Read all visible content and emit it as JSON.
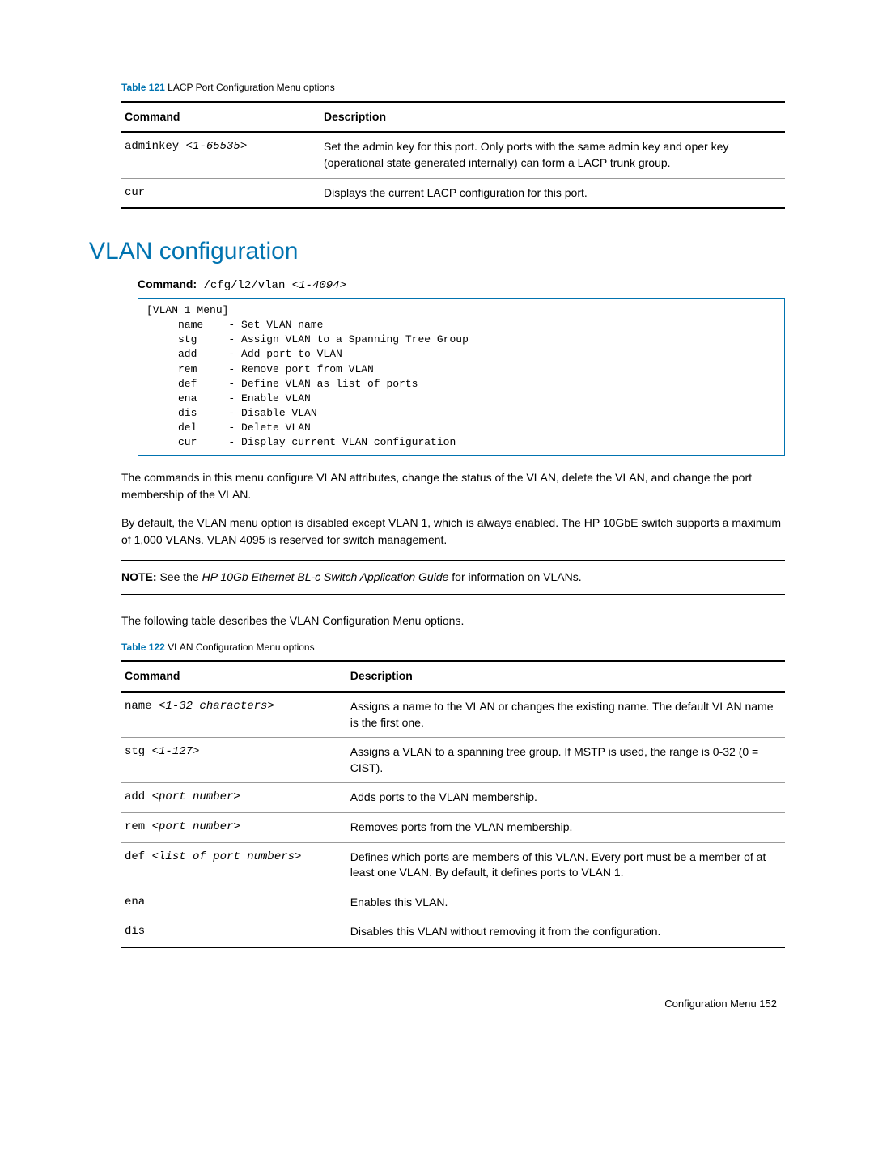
{
  "table121": {
    "caption_num": "Table 121",
    "caption_title": "  LACP Port Configuration Menu options",
    "header_cmd": "Command",
    "header_desc": "Description",
    "rows": [
      {
        "cmd_pre": "adminkey <",
        "cmd_arg": "1-65535",
        "cmd_post": ">",
        "desc": "Set the admin key for this port. Only ports with the same admin key and oper key (operational state generated internally) can form a LACP trunk group."
      },
      {
        "cmd_pre": "cur",
        "cmd_arg": "",
        "cmd_post": "",
        "desc": "Displays the current LACP configuration for this port."
      }
    ]
  },
  "section": {
    "heading": "VLAN configuration",
    "cmd_label": "Command:",
    "cmd_text": " /cfg/l2/vlan ",
    "cmd_arg": "<1-4094>",
    "code": "[VLAN 1 Menu]\n     name    - Set VLAN name\n     stg     - Assign VLAN to a Spanning Tree Group\n     add     - Add port to VLAN\n     rem     - Remove port from VLAN\n     def     - Define VLAN as list of ports\n     ena     - Enable VLAN\n     dis     - Disable VLAN\n     del     - Delete VLAN\n     cur     - Display current VLAN configuration",
    "para1": "The commands in this menu configure VLAN attributes, change the status of the VLAN, delete the VLAN, and change the port membership of the VLAN.",
    "para2": "By default, the VLAN menu option is disabled except VLAN 1, which is always enabled. The HP 10GbE switch supports a maximum of 1,000 VLANs. VLAN 4095 is reserved for switch management.",
    "note_label": "NOTE:",
    "note_pre": " See the ",
    "note_italic": "HP 10Gb Ethernet BL-c Switch Application Guide",
    "note_post": " for information on VLANs.",
    "para3": "The following table describes the VLAN Configuration Menu options."
  },
  "table122": {
    "caption_num": "Table 122",
    "caption_title": "  VLAN Configuration Menu options",
    "header_cmd": "Command",
    "header_desc": "Description",
    "rows": [
      {
        "cmd_pre": "name ",
        "cmd_arg": "<1-32 characters>",
        "cmd_post": "",
        "desc": "Assigns a name to the VLAN or changes the existing name. The default VLAN name is the first one."
      },
      {
        "cmd_pre": "stg ",
        "cmd_arg": "<1-127>",
        "cmd_post": "",
        "desc": "Assigns a VLAN to a spanning tree group. If MSTP is used, the range is 0-32 (0 = CIST)."
      },
      {
        "cmd_pre": "add ",
        "cmd_arg": "<port number>",
        "cmd_post": "",
        "desc": "Adds ports to the VLAN membership."
      },
      {
        "cmd_pre": "rem ",
        "cmd_arg": "<port number>",
        "cmd_post": "",
        "desc": "Removes ports from the VLAN membership."
      },
      {
        "cmd_pre": "def ",
        "cmd_arg": "<list of port numbers>",
        "cmd_post": "",
        "desc": "Defines which ports are members of this VLAN. Every port must be a member of at least one VLAN. By default, it defines ports to VLAN 1."
      },
      {
        "cmd_pre": "ena",
        "cmd_arg": "",
        "cmd_post": "",
        "desc": "Enables this VLAN."
      },
      {
        "cmd_pre": "dis",
        "cmd_arg": "",
        "cmd_post": "",
        "desc": "Disables this VLAN without removing it from the configuration."
      }
    ]
  },
  "footer": {
    "text": "Configuration Menu   152"
  }
}
